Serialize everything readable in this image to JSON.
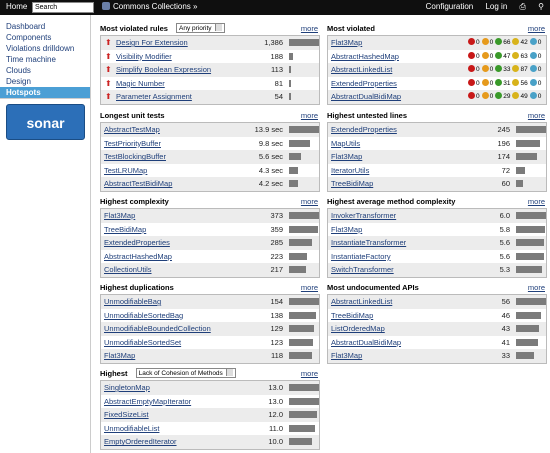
{
  "topbar": {
    "home": "Home",
    "search_value": "Search",
    "project": "Commons Collections »",
    "configuration": "Configuration",
    "login": "Log in"
  },
  "sidebar": {
    "items": [
      {
        "label": "Dashboard"
      },
      {
        "label": "Components"
      },
      {
        "label": "Violations drilldown"
      },
      {
        "label": "Time machine"
      },
      {
        "label": "Clouds"
      },
      {
        "label": "Design"
      },
      {
        "label": "Hotspots"
      }
    ],
    "logo": "sonar"
  },
  "more_label": "more",
  "most_violated_rules": {
    "title": "Most violated rules",
    "priority": "Any priority",
    "rows": [
      {
        "name": "Design For Extension",
        "value": "1,386",
        "fill": 1.0
      },
      {
        "name": "Visibility Modifier",
        "value": "188",
        "fill": 0.14
      },
      {
        "name": "Simplify Boolean Expression",
        "value": "113",
        "fill": 0.08
      },
      {
        "name": "Magic Number",
        "value": "81",
        "fill": 0.06
      },
      {
        "name": "Parameter Assignment",
        "value": "54",
        "fill": 0.04
      }
    ]
  },
  "most_violated": {
    "title": "Most violated",
    "rows": [
      {
        "name": "Flat3Map",
        "blocker": "0",
        "critical": "0",
        "major": "66",
        "minor": "42",
        "info": "0"
      },
      {
        "name": "AbstractHashedMap",
        "blocker": "0",
        "critical": "0",
        "major": "47",
        "minor": "63",
        "info": "0"
      },
      {
        "name": "AbstractLinkedList",
        "blocker": "0",
        "critical": "0",
        "major": "33",
        "minor": "87",
        "info": "0"
      },
      {
        "name": "ExtendedProperties",
        "blocker": "0",
        "critical": "0",
        "major": "31",
        "minor": "56",
        "info": "0"
      },
      {
        "name": "AbstractDualBidiMap",
        "blocker": "0",
        "critical": "0",
        "major": "29",
        "minor": "49",
        "info": "0"
      }
    ]
  },
  "longest_unit_tests": {
    "title": "Longest unit tests",
    "rows": [
      {
        "name": "AbstractTestMap",
        "value": "13.9 sec",
        "fill": 1.0
      },
      {
        "name": "TestPriorityBuffer",
        "value": "9.8 sec",
        "fill": 0.7
      },
      {
        "name": "TestBlockingBuffer",
        "value": "5.6 sec",
        "fill": 0.4
      },
      {
        "name": "TestLRUMap",
        "value": "4.3 sec",
        "fill": 0.31
      },
      {
        "name": "AbstractTestBidiMap",
        "value": "4.2 sec",
        "fill": 0.3
      }
    ]
  },
  "highest_untested_lines": {
    "title": "Highest untested lines",
    "rows": [
      {
        "name": "ExtendedProperties",
        "value": "245",
        "fill": 1.0
      },
      {
        "name": "MapUtils",
        "value": "196",
        "fill": 0.8
      },
      {
        "name": "Flat3Map",
        "value": "174",
        "fill": 0.71
      },
      {
        "name": "IteratorUtils",
        "value": "72",
        "fill": 0.29
      },
      {
        "name": "TreeBidiMap",
        "value": "60",
        "fill": 0.24
      }
    ]
  },
  "highest_complexity": {
    "title": "Highest complexity",
    "rows": [
      {
        "name": "Flat3Map",
        "value": "373",
        "fill": 1.0
      },
      {
        "name": "TreeBidiMap",
        "value": "359",
        "fill": 0.96
      },
      {
        "name": "ExtendedProperties",
        "value": "285",
        "fill": 0.76
      },
      {
        "name": "AbstractHashedMap",
        "value": "223",
        "fill": 0.6
      },
      {
        "name": "CollectionUtils",
        "value": "217",
        "fill": 0.58
      }
    ]
  },
  "highest_avg_method_complexity": {
    "title": "Highest average method complexity",
    "rows": [
      {
        "name": "InvokerTransformer",
        "value": "6.0",
        "fill": 1.0
      },
      {
        "name": "Flat3Map",
        "value": "5.8",
        "fill": 0.97
      },
      {
        "name": "InstantiateTransformer",
        "value": "5.6",
        "fill": 0.93
      },
      {
        "name": "InstantiateFactory",
        "value": "5.6",
        "fill": 0.93
      },
      {
        "name": "SwitchTransformer",
        "value": "5.3",
        "fill": 0.88
      }
    ]
  },
  "highest_duplications": {
    "title": "Highest duplications",
    "rows": [
      {
        "name": "UnmodifiableBag",
        "value": "154",
        "fill": 1.0
      },
      {
        "name": "UnmodifiableSortedBag",
        "value": "138",
        "fill": 0.9
      },
      {
        "name": "UnmodifiableBoundedCollection",
        "value": "129",
        "fill": 0.84
      },
      {
        "name": "UnmodifiableSortedSet",
        "value": "123",
        "fill": 0.8
      },
      {
        "name": "Flat3Map",
        "value": "118",
        "fill": 0.77
      }
    ]
  },
  "most_undocumented_apis": {
    "title": "Most undocumented APIs",
    "rows": [
      {
        "name": "AbstractLinkedList",
        "value": "56",
        "fill": 1.0
      },
      {
        "name": "TreeBidiMap",
        "value": "46",
        "fill": 0.82
      },
      {
        "name": "ListOrderedMap",
        "value": "43",
        "fill": 0.77
      },
      {
        "name": "AbstractDualBidiMap",
        "value": "41",
        "fill": 0.73
      },
      {
        "name": "Flat3Map",
        "value": "33",
        "fill": 0.59
      }
    ]
  },
  "highest_lcom": {
    "title": "Highest",
    "metric": "Lack of Cohesion of Methods",
    "rows": [
      {
        "name": "SingletonMap",
        "value": "13.0",
        "fill": 1.0
      },
      {
        "name": "AbstractEmptyMapIterator",
        "value": "13.0",
        "fill": 1.0
      },
      {
        "name": "FixedSizeList",
        "value": "12.0",
        "fill": 0.92
      },
      {
        "name": "UnmodifiableList",
        "value": "11.0",
        "fill": 0.85
      },
      {
        "name": "EmptyOrderedIterator",
        "value": "10.0",
        "fill": 0.77
      }
    ]
  }
}
